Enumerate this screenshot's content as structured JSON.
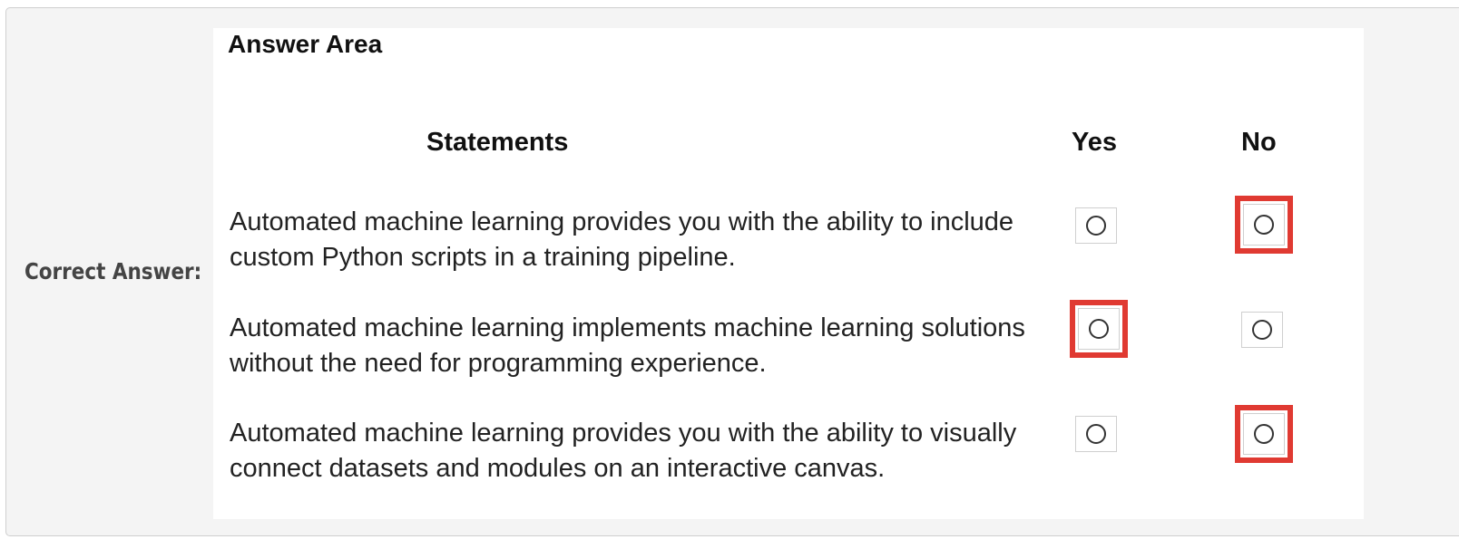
{
  "label": "Correct Answer:",
  "answer_area": {
    "title": "Answer Area",
    "headers": {
      "statements": "Statements",
      "yes": "Yes",
      "no": "No"
    },
    "rows": [
      {
        "line1": "Automated machine learning provides you with the ability to include",
        "line2": "custom Python scripts in a training pipeline.",
        "selected": "No"
      },
      {
        "line1": "Automated machine learning implements machine learning solutions",
        "line2": "without the need for programming experience.",
        "selected": "Yes"
      },
      {
        "line1": "Automated machine learning provides you with the ability to visually",
        "line2": "connect datasets and modules on an interactive canvas.",
        "selected": "No"
      }
    ]
  },
  "colors": {
    "highlight": "#e03a32",
    "panel_background": "#f4f4f4"
  }
}
